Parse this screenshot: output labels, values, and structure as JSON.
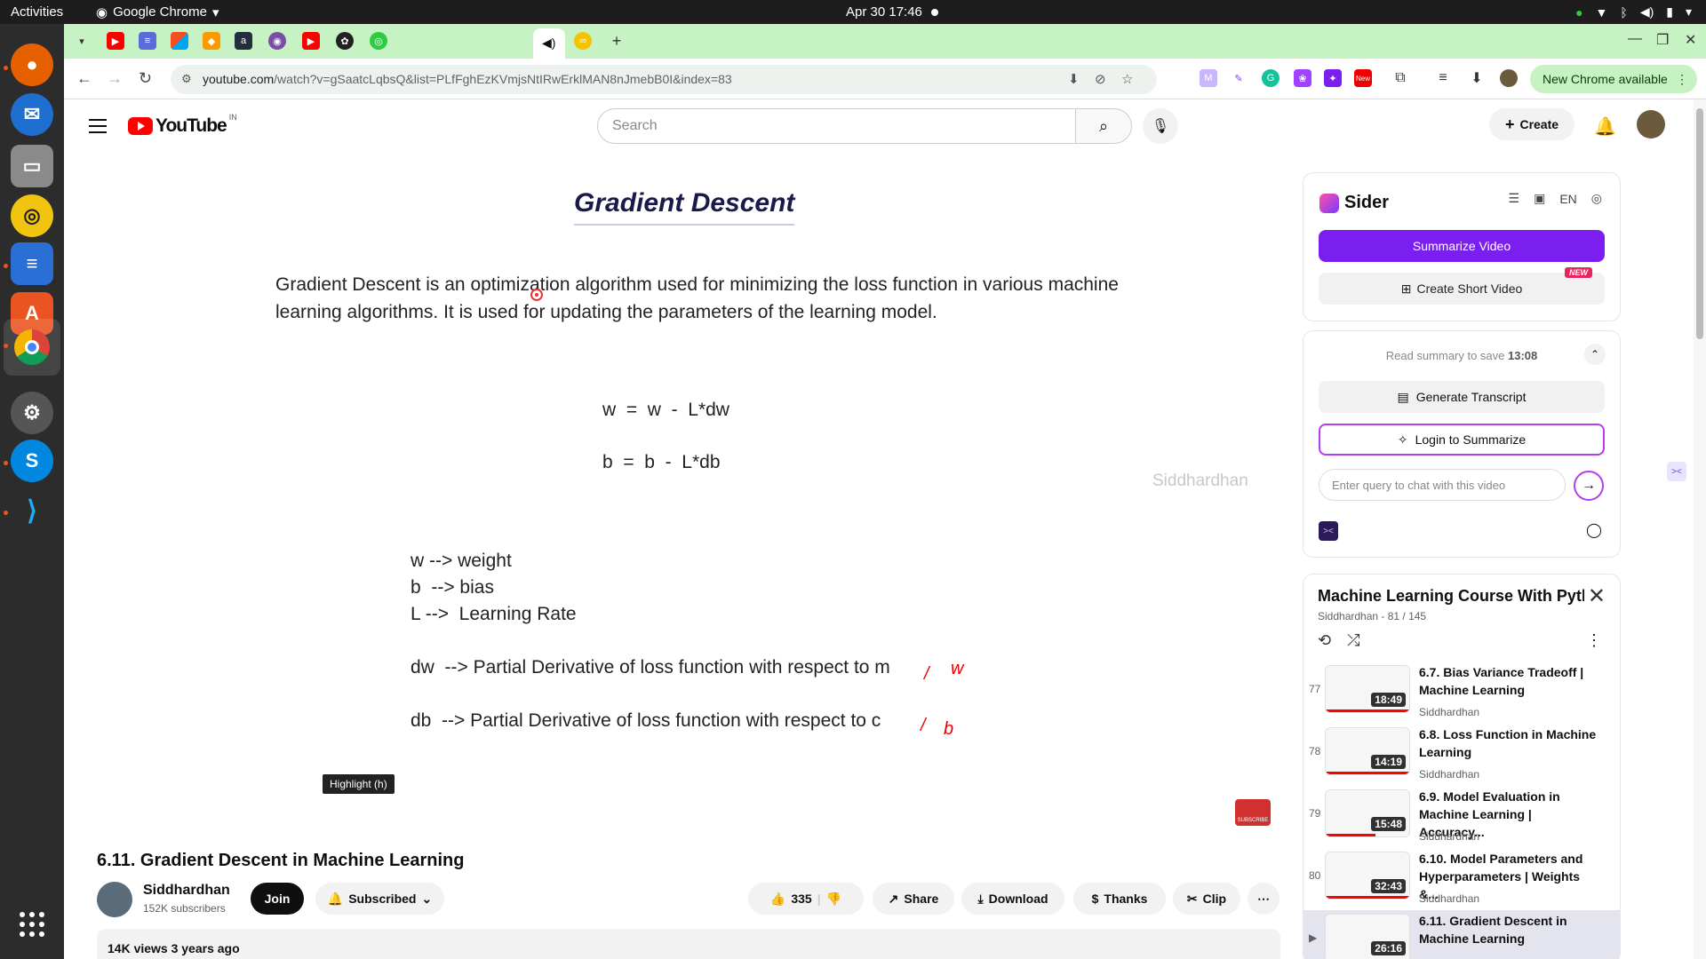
{
  "system": {
    "activities": "Activities",
    "app_name": "Google Chrome",
    "clock": "Apr 30  17:46"
  },
  "browser": {
    "url_host": "youtube.com",
    "url_rest": "/watch?v=gSaatcLqbsQ&list=PLfFghEzKVmjsNtIRwErklMAN8nJmebB0I&index=83",
    "new_chrome": "New Chrome available",
    "ext_new_badge": "New"
  },
  "youtube": {
    "logo": "YouTube",
    "country": "IN",
    "search_placeholder": "Search",
    "create": "Create"
  },
  "video": {
    "slide_title": "Gradient Descent",
    "description": "Gradient Descent is an optimization algorithm used for minimizing the loss function in various machine learning algorithms. It is used for updating the parameters of the learning model.",
    "eq1": "w  =  w  -  L*dw",
    "eq2": "b  =  b  -  L*db",
    "watermark": "Siddhardhan",
    "legend": [
      "w --> weight",
      "b  --> bias",
      "L -->  Learning Rate",
      "dw  --> Partial Derivative of loss function with respect to m",
      "db  --> Partial Derivative of loss function with respect to c"
    ],
    "mark_w": "w",
    "mark_b": "b",
    "tooltip": "Highlight (h)",
    "subscribe": "SUBSCRIBE"
  },
  "meta": {
    "title": "6.11. Gradient Descent in Machine Learning",
    "channel": "Siddhardhan",
    "subs": "152K subscribers",
    "join": "Join",
    "subscribed": "Subscribed",
    "likes": "335",
    "share": "Share",
    "download": "Download",
    "thanks": "Thanks",
    "clip": "Clip",
    "views": "14K views  3 years ago"
  },
  "sider": {
    "name": "Sider",
    "lang": "EN",
    "summarize": "Summarize Video",
    "short": "Create Short Video",
    "new": "NEW",
    "save_prefix": "Read summary to save ",
    "save_time": "13:08",
    "transcript": "Generate Transcript",
    "login": "Login to Summarize",
    "chat_placeholder": "Enter query to chat with this video"
  },
  "playlist": {
    "title": "Machine Learning Course With Pyth...",
    "sub": "Siddhardhan - 81 / 145",
    "items": [
      {
        "num": "77",
        "title": "6.7. Bias Variance Tradeoff | Machine Learning",
        "author": "Siddhardhan",
        "dur": "18:49"
      },
      {
        "num": "78",
        "title": "6.8. Loss Function in Machine Learning",
        "author": "Siddhardhan",
        "dur": "14:19"
      },
      {
        "num": "79",
        "title": "6.9. Model Evaluation in Machine Learning | Accuracy...",
        "author": "Siddhardhan",
        "dur": "15:48"
      },
      {
        "num": "80",
        "title": "6.10. Model Parameters and Hyperparameters | Weights &...",
        "author": "Siddhardhan",
        "dur": "32:43"
      },
      {
        "num": "▶",
        "title": "6.11. Gradient Descent in Machine Learning",
        "author": "",
        "dur": "26:16"
      }
    ]
  },
  "colors": {
    "tabstrip": "#c6f2c4",
    "yt_red": "#ff0000",
    "sider_purple": "#7b1ef0"
  }
}
